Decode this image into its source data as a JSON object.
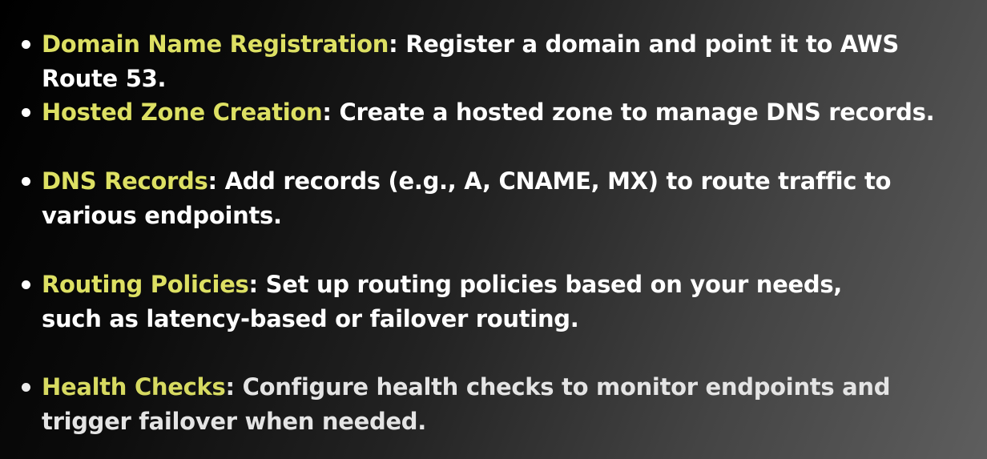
{
  "items": [
    {
      "term": "Domain Name Registration",
      "separator": ":",
      "description": " Register a domain and point it to AWS Route 53."
    },
    {
      "term": "Hosted Zone Creation",
      "separator": ":",
      "description": " Create a hosted zone to manage DNS records."
    },
    {
      "term": "DNS Records",
      "separator": ":",
      "description": " Add records (e.g., A, CNAME, MX) to route traffic to various endpoints."
    },
    {
      "term": "Routing Policies",
      "separator": ":",
      "description": " Set up routing policies based on your needs, such as latency-based or failover routing."
    },
    {
      "term": "Health Checks",
      "separator": ":",
      "description": " Configure health checks to monitor endpoints and trigger failover when needed."
    }
  ],
  "colors": {
    "term_highlight": "#dde063",
    "text": "#ffffff",
    "background_dark": "#000000",
    "background_light": "#5e5e5e"
  }
}
